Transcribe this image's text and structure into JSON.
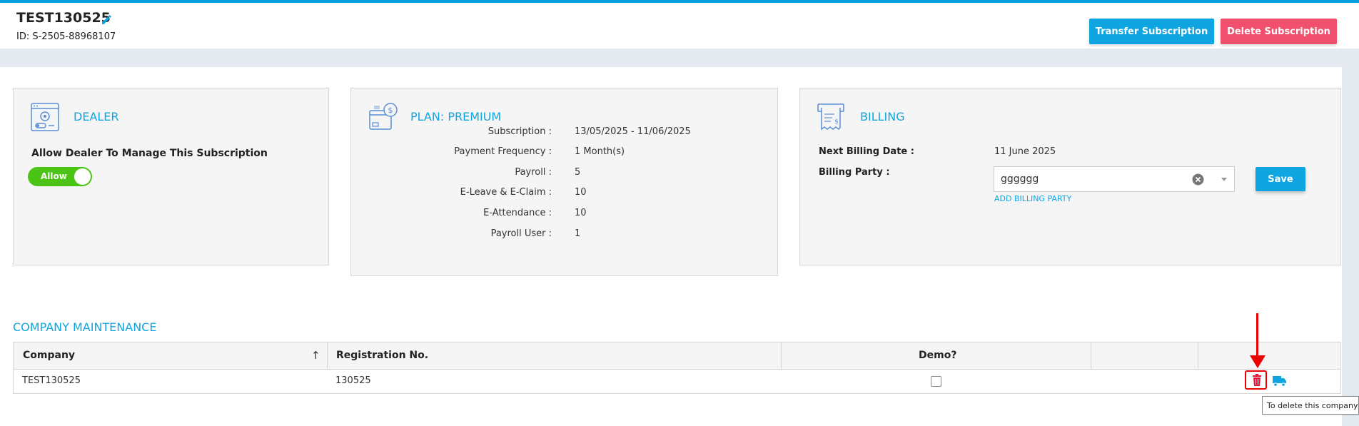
{
  "header": {
    "title": "TEST130525",
    "id_text": "ID: S-2505-88968107",
    "transfer_label": "Transfer Subscription",
    "delete_label": "Delete Subscription"
  },
  "dealer": {
    "title": "DEALER",
    "label": "Allow Dealer To Manage This Subscription",
    "toggle_label": "Allow",
    "toggle_on": true
  },
  "plan": {
    "title": "PLAN: PREMIUM",
    "rows": [
      {
        "label": "Subscription :",
        "value": "13/05/2025 - 11/06/2025"
      },
      {
        "label": "Payment Frequency :",
        "value": "1 Month(s)"
      },
      {
        "label": "Payroll :",
        "value": "5"
      },
      {
        "label": "E-Leave & E-Claim :",
        "value": "10"
      },
      {
        "label": "E-Attendance :",
        "value": "10"
      },
      {
        "label": "Payroll User :",
        "value": "1"
      }
    ]
  },
  "billing": {
    "title": "BILLING",
    "next_label": "Next Billing Date :",
    "next_value": "11 June 2025",
    "party_label": "Billing Party :",
    "party_value": "gggggg",
    "add_link": "ADD BILLING PARTY",
    "save_label": "Save"
  },
  "company": {
    "section_title": "COMPANY MAINTENANCE",
    "columns": [
      "Company",
      "Registration No.",
      "Demo?"
    ],
    "rows": [
      {
        "company": "TEST130525",
        "registration": "130525",
        "demo": false
      }
    ]
  },
  "tooltip": "To delete this company",
  "colors": {
    "accent": "#0ea5e0",
    "danger": "#f0506e",
    "toggle_on": "#4cc415",
    "annotation": "#e00000"
  }
}
